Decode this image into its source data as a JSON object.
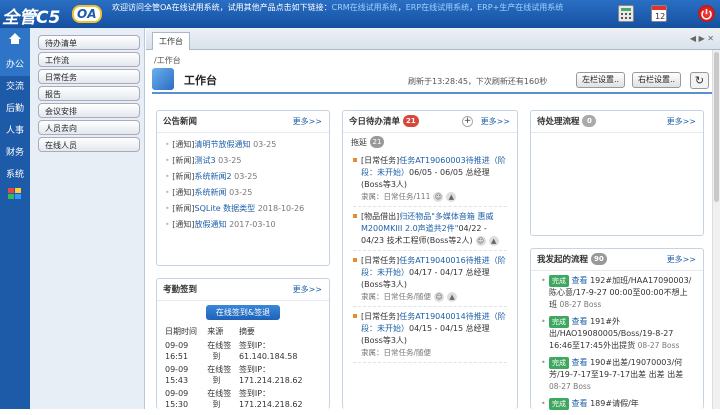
{
  "app": {
    "logo": "全管C5",
    "logo_oa": "OA",
    "welcome_prefix": "欢迎访问全管OA在线试用系统，试用其他产品点击如下链接：",
    "links": [
      "CRM在线试用系统",
      "ERP在线试用系统",
      "ERP+生产在线试用系统"
    ],
    "sep": "，"
  },
  "leftnav": [
    "办公",
    "交流",
    "后勤",
    "人事",
    "财务",
    "系统"
  ],
  "submenu": [
    "待办清单",
    "工作流",
    "日常任务",
    "报告",
    "会议安排",
    "人员去向",
    "在线人员"
  ],
  "tab": {
    "label": "工作台",
    "breadcrumb": "/工作台"
  },
  "header": {
    "title": "工作台",
    "refresh_text": "刷新于13:28:45，下次刷新还有160秒",
    "left_btn": "左栏设置..",
    "right_btn": "右栏设置..",
    "refresh_icon": "↻"
  },
  "notice": {
    "title": "公告新闻",
    "more": "更多>>",
    "items": [
      {
        "tag": "[通知]",
        "title": "清明节放假通知",
        "date": "03-25"
      },
      {
        "tag": "[新闻]",
        "title": "测试3",
        "date": "03-25"
      },
      {
        "tag": "[新闻]",
        "title": "系统新闻2",
        "date": "03-25"
      },
      {
        "tag": "[通知]",
        "title": "系统新闻",
        "date": "03-25"
      },
      {
        "tag": "[新闻]",
        "title": "SQLite 数据类型",
        "date": "2018-10-26"
      },
      {
        "tag": "[通知]",
        "title": "放假通知",
        "date": "2017-03-10"
      }
    ]
  },
  "attendance": {
    "title": "考勤签到",
    "more": "更多>>",
    "button": "在线签到&签退",
    "headers": [
      "日期时间",
      "来源",
      "摘要"
    ],
    "rows": [
      {
        "date": "09-09",
        "time": "16:51",
        "src1": "在线签",
        "src2": "到",
        "sum1": "签到IP：",
        "sum2": "61.140.184.58"
      },
      {
        "date": "09-09",
        "time": "15:43",
        "src1": "在线签",
        "src2": "到",
        "sum1": "签到IP：",
        "sum2": "171.214.218.62"
      },
      {
        "date": "09-09",
        "time": "15:30",
        "src1": "在线签",
        "src2": "到",
        "sum1": "签到IP：",
        "sum2": "171.214.218.62"
      }
    ]
  },
  "todo": {
    "title": "今日待办清单",
    "count": "21",
    "plus": "+",
    "more": "更多>>",
    "tab": "拖延",
    "tab_count": "21",
    "items": [
      {
        "prefix": "[日常任务]",
        "link": "任务AT19060003待推进（阶段：未开始）",
        "rest": "06/05 - 06/05 总经理(Boss等3人)",
        "meta": "隶属：日常任务/111"
      },
      {
        "prefix": "[物品借出]",
        "link": "归还物品\"多媒体音箱 惠威M200MKIII 2.0声道共2件\"",
        "rest": "04/22 - 04/23 技术工程师(Boss等2人)",
        "meta": ""
      },
      {
        "prefix": "[日常任务]",
        "link": "任务AT19040016待推进（阶段：未开始）",
        "rest": "04/17 - 04/17 总经理(Boss等3人)",
        "meta": "隶属：日常任务/随便"
      },
      {
        "prefix": "[日常任务]",
        "link": "任务AT19040014待推进（阶段：未开始）",
        "rest": "04/15 - 04/15 总经理(Boss等3人)",
        "meta": "隶属：日常任务/随便"
      }
    ]
  },
  "pending": {
    "title": "待处理流程",
    "count": "0",
    "more": "更多>>"
  },
  "myflows": {
    "title": "我发起的流程",
    "count": "90",
    "more": "更多>>",
    "status": "完成",
    "view": "查看",
    "items": [
      {
        "text": "192#加班/HAA17090003/陈心意/17-9-27 00:00至00:00不想上班",
        "meta": "08-27 Boss"
      },
      {
        "text": "191#外出/HAO19080005/Boss/19-8-27 16:46至17:45外出提货",
        "meta": "08-27 Boss"
      },
      {
        "text": "190#出差/19070003/何芳/19-7-17至19-7-17出差 出差 出差",
        "meta": "08-27 Boss"
      },
      {
        "text": "189#请假/年",
        "meta": ""
      }
    ]
  }
}
